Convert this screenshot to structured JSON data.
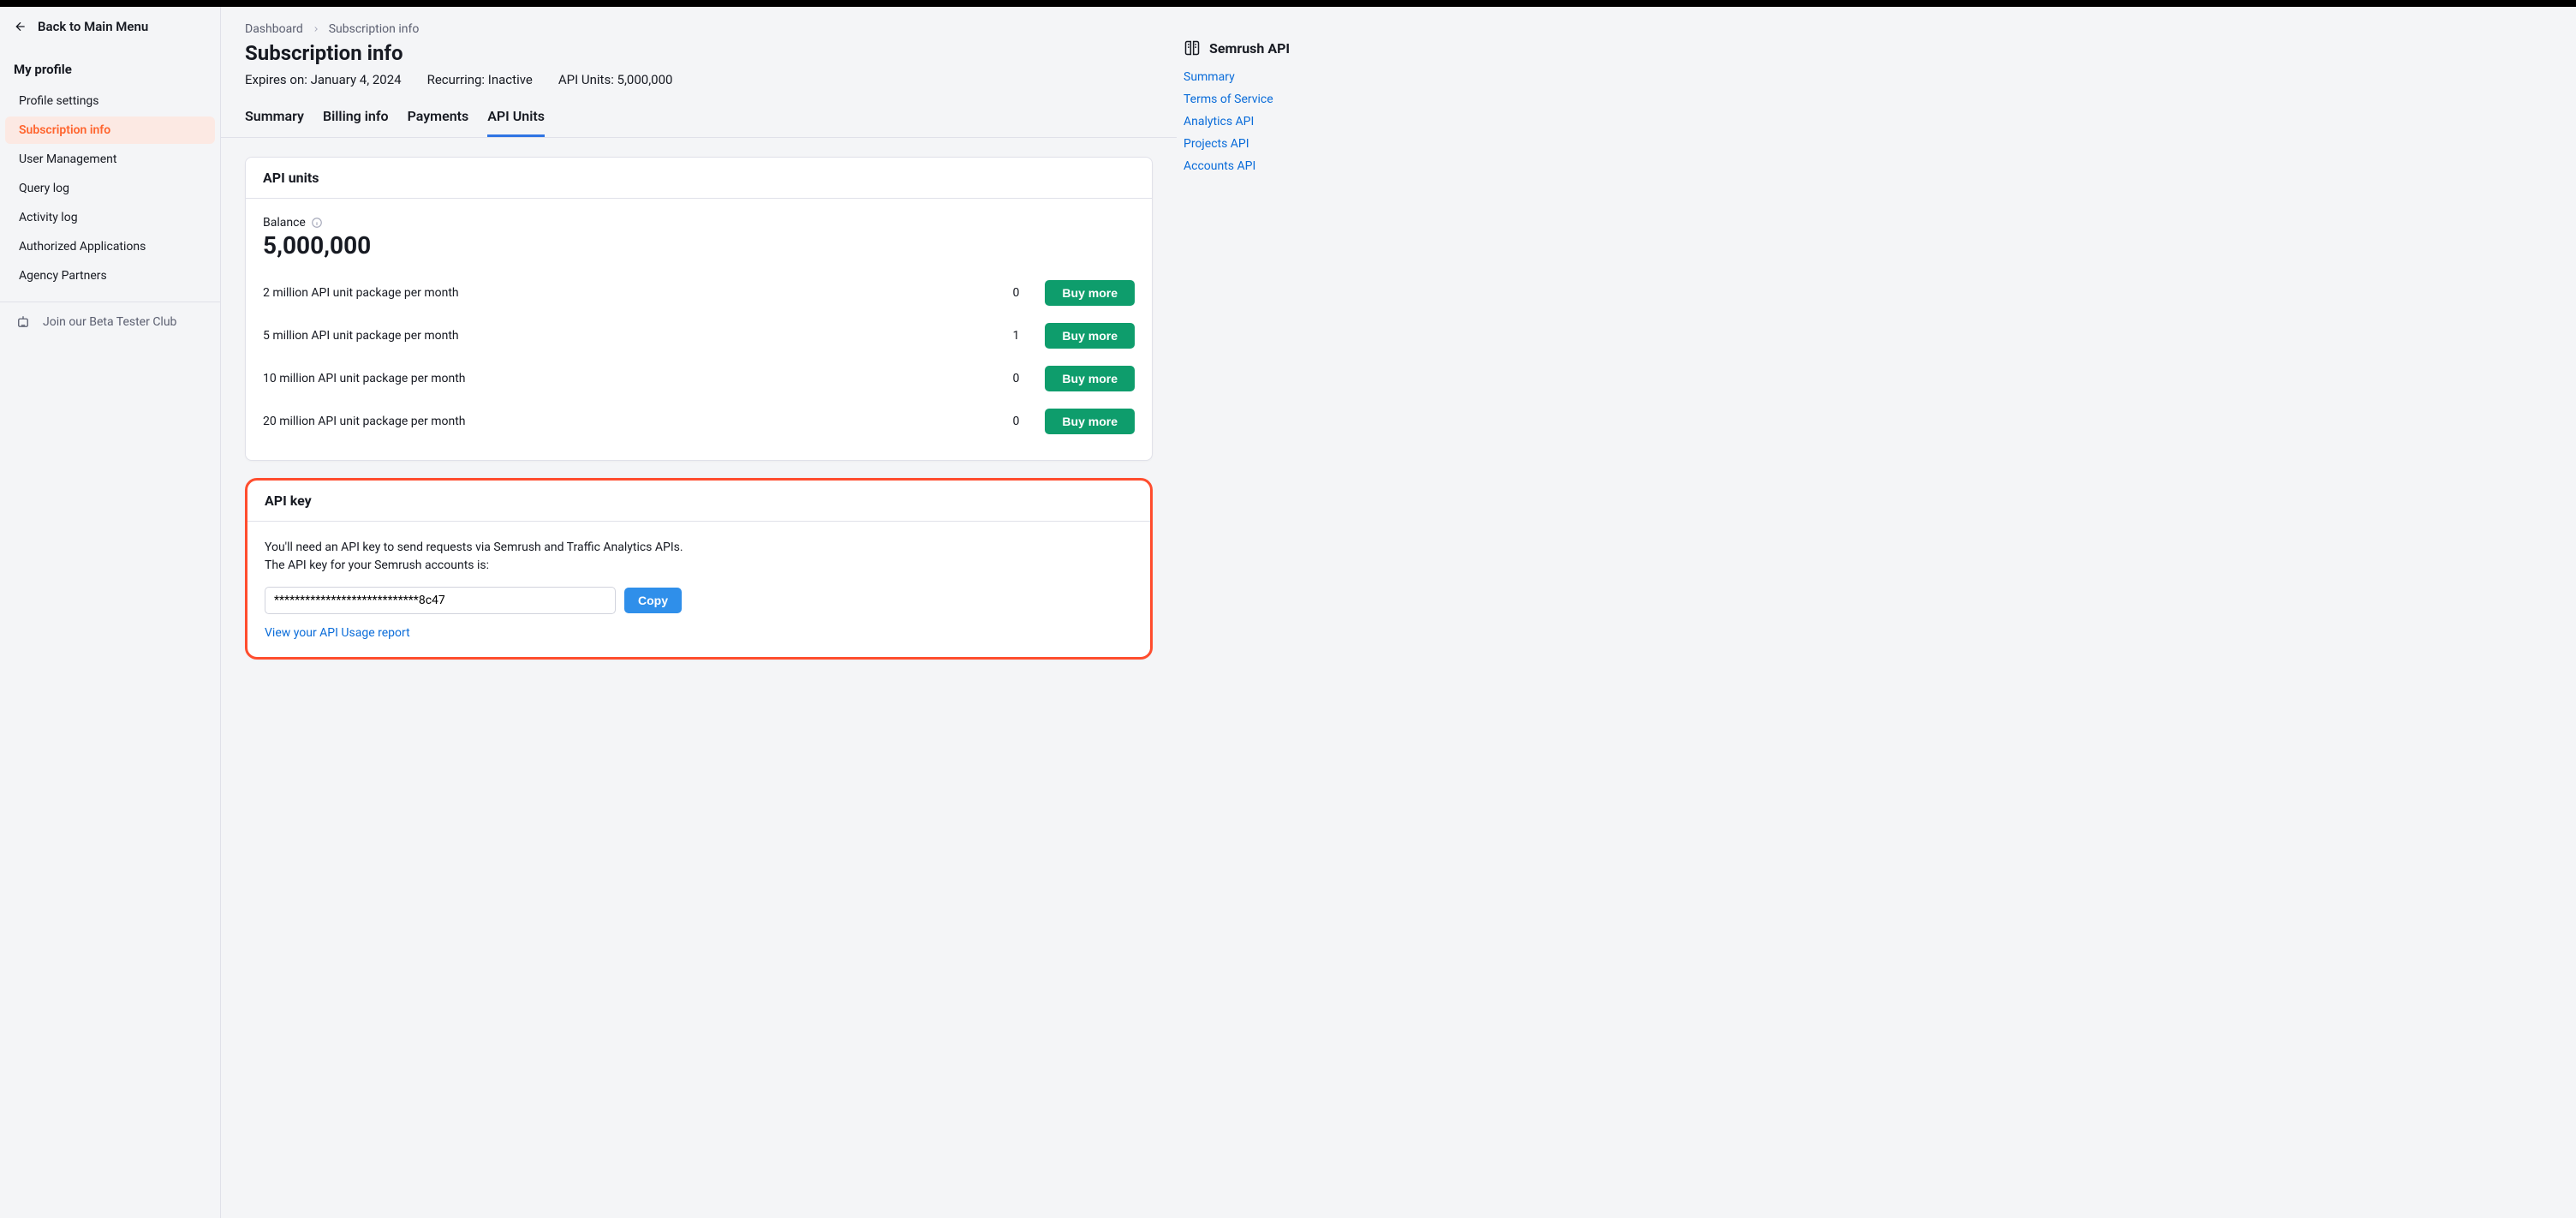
{
  "sidebar": {
    "back_label": "Back to Main Menu",
    "section_title": "My profile",
    "items": [
      {
        "label": "Profile settings"
      },
      {
        "label": "Subscription info"
      },
      {
        "label": "User Management"
      },
      {
        "label": "Query log"
      },
      {
        "label": "Activity log"
      },
      {
        "label": "Authorized Applications"
      },
      {
        "label": "Agency Partners"
      }
    ],
    "beta_label": "Join our Beta Tester Club"
  },
  "breadcrumb": {
    "root": "Dashboard",
    "current": "Subscription info"
  },
  "page": {
    "title": "Subscription info",
    "expires": "Expires on: January 4, 2024",
    "recurring": "Recurring: Inactive",
    "api_units": "API Units: 5,000,000"
  },
  "tabs": [
    {
      "label": "Summary"
    },
    {
      "label": "Billing info"
    },
    {
      "label": "Payments"
    },
    {
      "label": "API Units"
    }
  ],
  "api_units": {
    "title": "API units",
    "balance_label": "Balance",
    "balance_value": "5,000,000",
    "packages": [
      {
        "name": "2 million API unit package per month",
        "count": "0"
      },
      {
        "name": "5 million API unit package per month",
        "count": "1"
      },
      {
        "name": "10 million API unit package per month",
        "count": "0"
      },
      {
        "name": "20 million API unit package per month",
        "count": "0"
      }
    ],
    "buy_label": "Buy more"
  },
  "api_key": {
    "title": "API key",
    "desc_line1": "You'll need an API key to send requests via Semrush and Traffic Analytics APIs.",
    "desc_line2": "The API key for your Semrush accounts is:",
    "key_value": "****************************8c47",
    "copy_label": "Copy",
    "report_link": "View your API Usage report"
  },
  "right": {
    "title": "Semrush API",
    "links": [
      {
        "label": "Summary"
      },
      {
        "label": "Terms of Service"
      },
      {
        "label": "Analytics API"
      },
      {
        "label": "Projects API"
      },
      {
        "label": "Accounts API"
      }
    ]
  }
}
